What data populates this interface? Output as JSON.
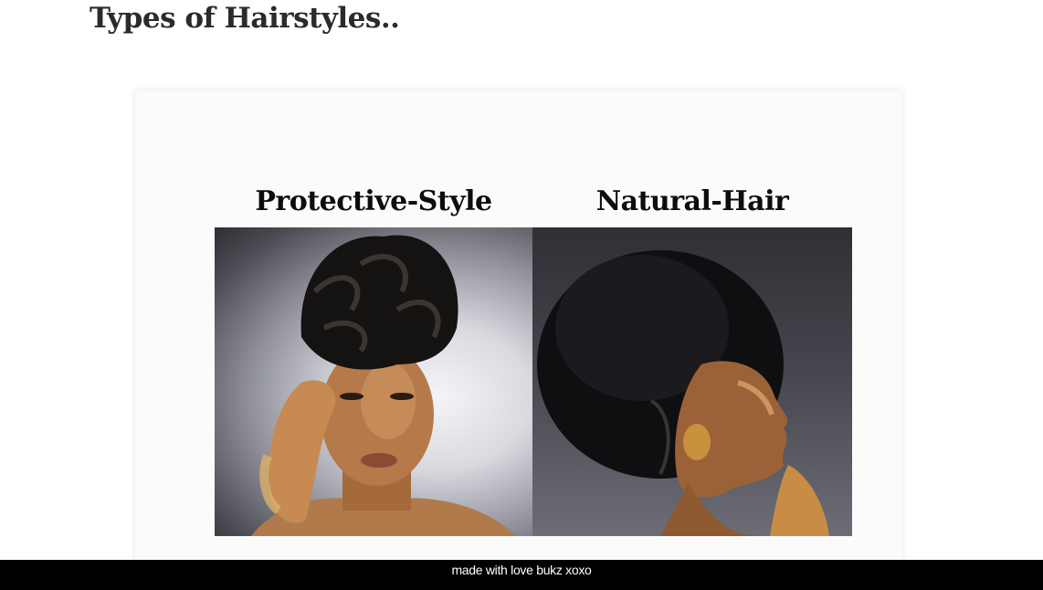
{
  "page": {
    "title": "Types of Hairstyles.."
  },
  "gallery": {
    "items": [
      {
        "heading": "Protective-Style",
        "image_icon": "protective-style-photo"
      },
      {
        "heading": "Natural-Hair",
        "image_icon": "natural-hair-photo"
      }
    ]
  },
  "footer": {
    "text": "made with love bukz xoxo"
  },
  "colors": {
    "footer_bg": "#000000",
    "title_text": "#2b2b2b",
    "card_bg": "#fbfbfb"
  }
}
